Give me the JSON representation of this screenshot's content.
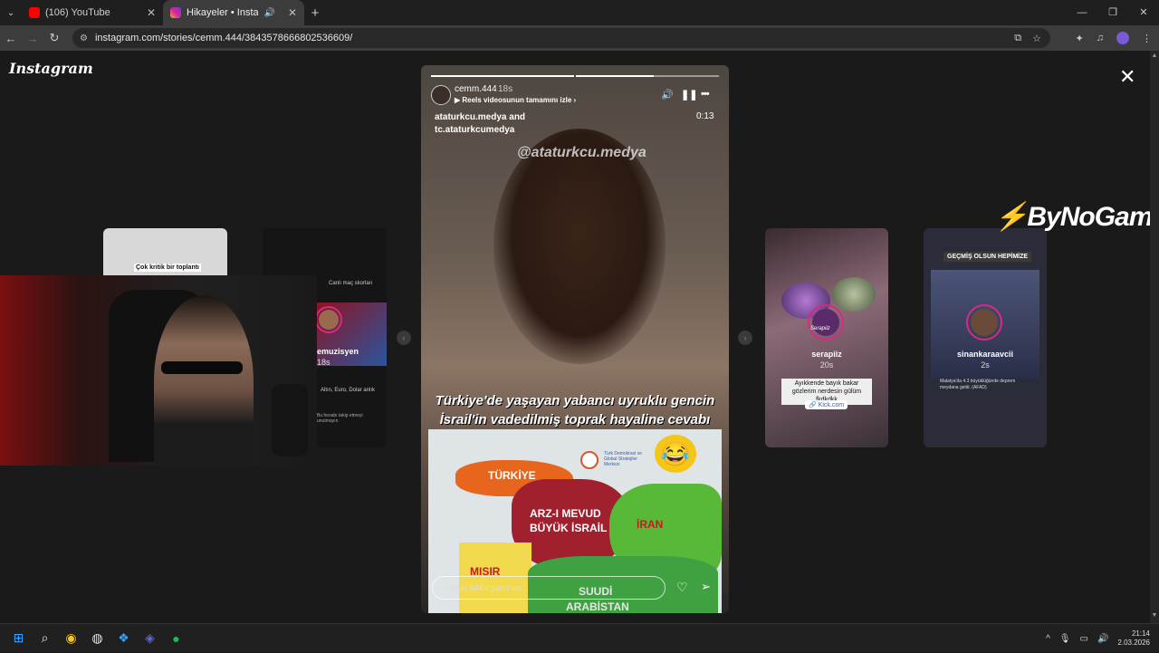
{
  "browser": {
    "tabs": [
      {
        "title": "(106) YouTube",
        "favicon_color": "#ff0000",
        "active": false
      },
      {
        "title": "Hikayeler • Instagram",
        "favicon_color": "#d6249f",
        "active": true
      }
    ],
    "url": "instagram.com/stories/cemm.444/3843578666802536609/",
    "window_controls": [
      "—",
      "❐",
      "✕"
    ]
  },
  "instagram": {
    "logo": "Instagram",
    "current_story": {
      "username": "cemm.444",
      "time_ago": "18s",
      "reels_link": "Reels videosunun tamamını izle",
      "source_line1": "ataturkcu.medya and",
      "source_line2": "tc.ataturkcumedya",
      "duration": "0:13",
      "watermark": "@ataturkcu.medya",
      "caption_line1": "Türkiye'de yaşayan yabancı uyruklu gencin",
      "caption_line2": "İsrail'in vadedilmiş toprak hayaline cevabı",
      "map_labels": {
        "turkiye": "TÜRKİYE",
        "israil1": "ARZ-I MEVUD",
        "israil2": "BÜYÜK İSRAİL",
        "iran": "İRAN",
        "misir": "MISIR",
        "suudi1": "SUUDİ",
        "suudi2": "ARABİSTAN",
        "logo_text": "Türk Demokrasi ve Global Stratejiler Merkezi"
      },
      "reply_placeholder": "cemm.444'e yanıt ver...",
      "progress_segments": 2,
      "progress_fraction": 0.5
    },
    "prev_stories": {
      "left_card_caption": "Çok kritik bir toplantı",
      "music_card": {
        "top_text": "Canlı maç skorları",
        "username": "emuzisyen",
        "time_ago": "18s",
        "bottom_text": "Altın, Euro, Dolar anlık",
        "footer": "Bu hesabı takip etmeyi unutmayın"
      }
    },
    "next_stories": [
      {
        "username": "serapiiz",
        "time_ago": "20s",
        "ring_label": "Serapiiz",
        "sticker": "Ayıkkende bayık bakar gözlerim nerdesin gülüm fkdkdkk",
        "link": "Kick.com"
      },
      {
        "username": "sinankaraavcii",
        "time_ago": "2s",
        "banner": "GEÇMİŞ OLSUN HEPİMİZE",
        "body": "Malatya'da 4.3 büyüklüğünde deprem meydana geldi. (AFAD)"
      }
    ]
  },
  "overlay": {
    "sponsor": "ByNoGame"
  },
  "taskbar": {
    "time": "21:14",
    "date": "2.03.2026"
  },
  "colors": {
    "turkiye": "#e8651e",
    "israil": "#a0202e",
    "iran": "#58b837",
    "misir": "#f2d94e",
    "suudi": "#3fa142"
  }
}
